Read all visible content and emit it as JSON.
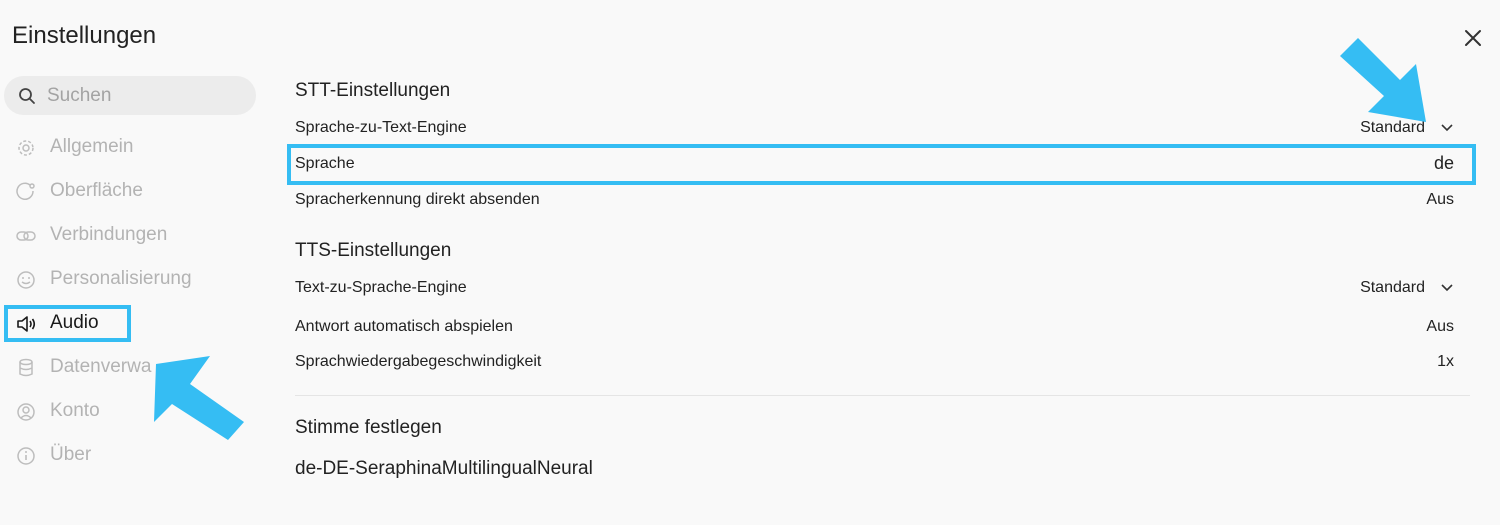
{
  "window": {
    "title": "Einstellungen"
  },
  "search": {
    "placeholder": "Suchen"
  },
  "sidebar": {
    "items": [
      {
        "label": "Allgemein",
        "icon": "gear-icon"
      },
      {
        "label": "Oberfläche",
        "icon": "interface-icon"
      },
      {
        "label": "Verbindungen",
        "icon": "link-icon"
      },
      {
        "label": "Personalisierung",
        "icon": "smiley-icon"
      },
      {
        "label": "Audio",
        "icon": "speaker-icon",
        "active": true
      },
      {
        "label": "Datenverwa",
        "icon": "database-icon"
      },
      {
        "label": "Konto",
        "icon": "user-icon"
      },
      {
        "label": "Über",
        "icon": "info-icon"
      }
    ]
  },
  "stt": {
    "title": "STT-Einstellungen",
    "engine_label": "Sprache-zu-Text-Engine",
    "engine_value": "Standard",
    "language_label": "Sprache",
    "language_value": "de",
    "autosend_label": "Spracherkennung direkt absenden",
    "autosend_value": "Aus"
  },
  "tts": {
    "title": "TTS-Einstellungen",
    "engine_label": "Text-zu-Sprache-Engine",
    "engine_value": "Standard",
    "autoplay_label": "Antwort automatisch abspielen",
    "autoplay_value": "Aus",
    "speed_label": "Sprachwiedergabegeschwindigkeit",
    "speed_value": "1x"
  },
  "voice": {
    "title": "Stimme festlegen",
    "value": "de-DE-SeraphinaMultilingualNeural"
  },
  "colors": {
    "highlight": "#35bdf3",
    "active_text": "#1a1a1a",
    "inactive_text": "#b3b3b3"
  }
}
